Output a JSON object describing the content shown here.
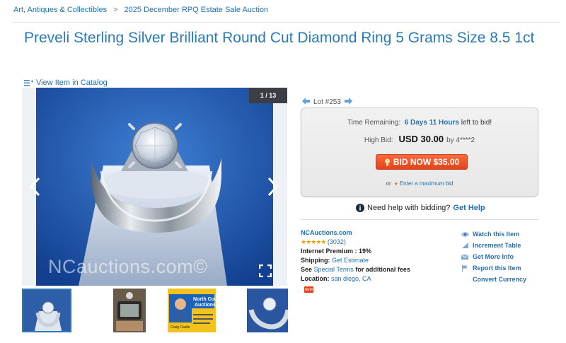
{
  "breadcrumb": {
    "items": [
      "Art, Antiques & Collectibles",
      "2025 December RPQ Estate Sale Auction"
    ],
    "separator": ">"
  },
  "item": {
    "title": "Preveli Sterling Silver Brilliant Round Cut Diamond Ring 5 Grams Size 8.5 1ct",
    "view_catalog": "View Item in Catalog"
  },
  "gallery": {
    "counter": "1 / 13",
    "watermark": "NCauctions.com©",
    "thumbs": [
      {
        "id": "thumb-1"
      },
      {
        "id": "thumb-2"
      },
      {
        "id": "thumb-3",
        "heading": "North County Auctions",
        "name": "Craig Castle"
      },
      {
        "id": "thumb-4"
      }
    ]
  },
  "lot": {
    "label": "Lot #253"
  },
  "bid": {
    "time_label": "Time Remaining:",
    "time_value": "6 Days 11 Hours",
    "time_suffix": "left to bid!",
    "high_label": "High Bid:",
    "high_value": "USD 30.00",
    "high_by": "by 4****2",
    "button": "BID NOW $35.00",
    "or": "or",
    "max_link": "Enter a maximum bid"
  },
  "help": {
    "text": "Need help with bidding?",
    "link": "Get Help"
  },
  "seller": {
    "name": "NCAuctions.com",
    "stars": "★★★★★",
    "reviews": "(3032)",
    "premium": "Internet Premium : 19%",
    "shipping_label": "Shipping:",
    "shipping_link": "Get Estimate",
    "see": "See",
    "terms_link": "Special Terms",
    "terms_suffix": "for additional fees",
    "location_label": "Location:",
    "location_value": "san diego, CA",
    "badge": "NEW"
  },
  "actions": [
    {
      "label": "Watch this Item",
      "icon": "eye-icon"
    },
    {
      "label": "Increment Table",
      "icon": "increment-icon"
    },
    {
      "label": "Get More Info",
      "icon": "mail-icon"
    },
    {
      "label": "Report this Item",
      "icon": "flag-icon"
    },
    {
      "label": "Convert Currency",
      "icon": "none"
    }
  ],
  "colors": {
    "link": "#1f6fb0",
    "title": "#2a7ab8",
    "bid_button": "#e1431b",
    "star": "#f0a000"
  }
}
